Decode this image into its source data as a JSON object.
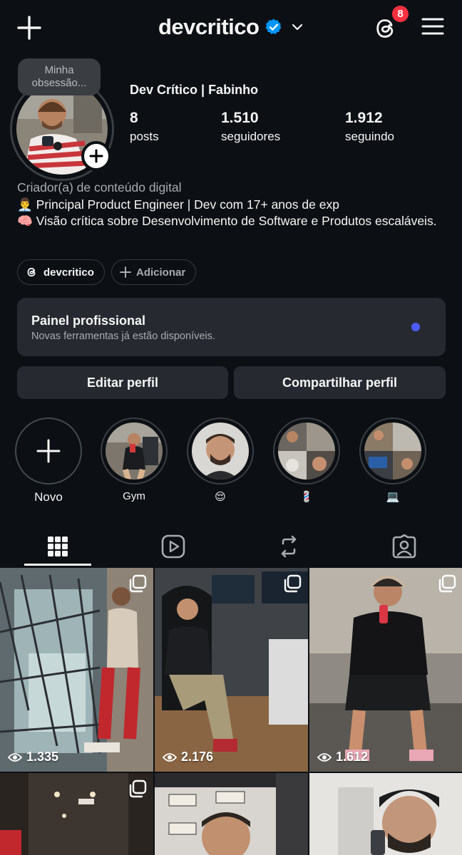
{
  "header": {
    "username": "devcritico",
    "verified_icon": "verified-badge-icon",
    "notification_count": "8"
  },
  "profile": {
    "note": "Minha obsessão...",
    "display_name": "Dev Crítico | Fabinho",
    "stats": [
      {
        "value": "8",
        "label": "posts"
      },
      {
        "value": "1.510",
        "label": "seguidores"
      },
      {
        "value": "1.912",
        "label": "seguindo"
      }
    ],
    "category": "Criador(a) de conteúdo digital",
    "bio_line1": "👨‍💼 Principal Product Engineer | Dev com 17+ anos de exp",
    "bio_line2": "🧠 Visão crítica sobre Desenvolvimento de Software e Produtos escaláveis."
  },
  "chips": {
    "threads_label": "devcritico",
    "add_label": "Adicionar"
  },
  "panel": {
    "title": "Painel profissional",
    "subtitle": "Novas ferramentas já estão disponíveis.",
    "dot_color": "#4e5cf8"
  },
  "actions": {
    "edit": "Editar perfil",
    "share": "Compartilhar perfil"
  },
  "highlights": [
    {
      "label": "Novo"
    },
    {
      "label": "Gym"
    },
    {
      "label": "😌"
    },
    {
      "label": "💈"
    },
    {
      "label": "💻"
    }
  ],
  "tabs": [
    "grid-icon",
    "reels-icon",
    "reposts-icon",
    "tagged-icon"
  ],
  "posts": [
    {
      "views": "1.335"
    },
    {
      "views": "2.176"
    },
    {
      "views": "1.612"
    },
    {
      "views": ""
    },
    {
      "views": ""
    },
    {
      "views": ""
    }
  ],
  "colors": {
    "background": "#0c1014",
    "surface": "#262a30",
    "badge": "#ff3040",
    "verified": "#0095f6"
  }
}
